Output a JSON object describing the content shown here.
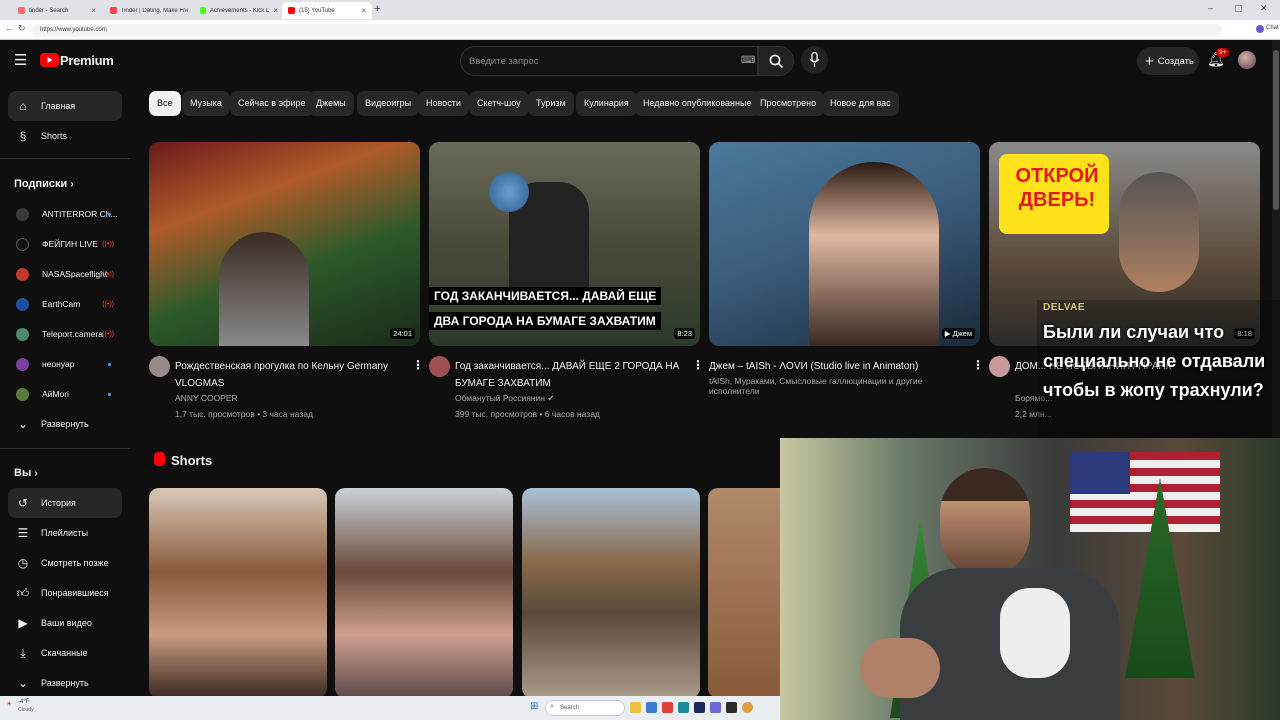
{
  "browser": {
    "tabs": [
      {
        "label": "tinder - Search"
      },
      {
        "label": "Tinder | Dating, Make Friends & Me..."
      },
      {
        "label": "Achievements - Kick Dashboard"
      },
      {
        "label": "(15) YouTube"
      }
    ],
    "url": "https://www.youtube.com",
    "new_tab": "+",
    "profile_label": "Chat"
  },
  "header": {
    "logo_text": "Premium",
    "search_placeholder": "Введите запрос",
    "create_label": "Создать",
    "notifications_badge": "9+"
  },
  "chips": [
    "Все",
    "Музыка",
    "Сейчас в эфире",
    "Джемы",
    "Видеоигры",
    "Новости",
    "Скетч-шоу",
    "Туризм",
    "Кулинария",
    "Недавно опубликованные",
    "Просмотрено",
    "Новое для вас"
  ],
  "sidebar": {
    "main": [
      {
        "label": "Главная",
        "icon": "home-icon"
      },
      {
        "label": "Shorts",
        "icon": "shorts-icon"
      }
    ],
    "subs_header": "Подписки",
    "subscriptions": [
      {
        "label": "ANTITERROR Ch...",
        "indicator": "dot",
        "color": "#3a3a3a"
      },
      {
        "label": "ФЕЙГИН LIVE",
        "indicator": "live",
        "color": "#1a1a1a"
      },
      {
        "label": "NASASpaceflight",
        "indicator": "live",
        "color": "#c0392b"
      },
      {
        "label": "EarthCam",
        "indicator": "live",
        "color": "#1f4fa0"
      },
      {
        "label": "Teleport.camera",
        "indicator": "live",
        "color": "#4a8a6a"
      },
      {
        "label": "неонуар",
        "indicator": "dot",
        "color": "#7b3fa0"
      },
      {
        "label": "АйМori",
        "indicator": "dot",
        "color": "#5a7a3a"
      }
    ],
    "expand_label": "Развернуть",
    "you_header": "Вы",
    "you_items": [
      {
        "label": "История",
        "icon": "history-icon"
      },
      {
        "label": "Плейлисты",
        "icon": "playlists-icon"
      },
      {
        "label": "Смотреть позже",
        "icon": "watch-later-icon"
      },
      {
        "label": "Понравившиеся",
        "icon": "like-icon"
      },
      {
        "label": "Ваши видео",
        "icon": "your-videos-icon"
      },
      {
        "label": "Скачанные",
        "icon": "downloads-icon"
      },
      {
        "label": "Развернуть",
        "icon": "chevron-down-icon"
      }
    ]
  },
  "videos": [
    {
      "title": "Рождественская прогулка по Кельну Germany VLOGMAS",
      "channel": "ANNY COOPER",
      "stats": "1,7 тыс. просмотров • 3 часа назад",
      "duration": "24:01",
      "overlay_text": ""
    },
    {
      "title": "Год заканчивается... ДАВАЙ ЕЩЕ 2 ГОРОДА НА БУМАГЕ ЗАХВАТИМ",
      "channel": "Обманутый Россиянин",
      "stats": "399 тыс. просмотров • 6 часов назад",
      "duration": "8:23",
      "overlay_line1": "ГОД ЗАКАНЧИВАЕТСЯ... ДАВАЙ ЕЩЕ",
      "overlay_line2": "ДВА ГОРОДА НА БУМАГЕ ЗАХВАТИМ"
    },
    {
      "title": "Джем – tAISh - ΛOVИ (Studio live in Animaton)",
      "channel": "tAISh, Мураками, Смысловые галлюцинации и другие исполнители",
      "stats": "",
      "duration": "▶ Джем"
    },
    {
      "title": "ДОМ... НЕ ИСПЫТАНИЯ / ПРАНК",
      "channel": "Борямо...",
      "stats": "2,2 млн...",
      "duration": "8:18",
      "overlay_text": "ОТКРОЙ ДВЕРЬ!"
    }
  ],
  "shorts_header": "Shorts",
  "stream_overlay": {
    "brand": "DELVAE",
    "caption": "Были ли случаи что специально не отдавали чтобы в жопу трахнули?"
  },
  "taskbar": {
    "weather": "-4°F",
    "weather_sub": "Cloudy",
    "search_label": "Search"
  }
}
